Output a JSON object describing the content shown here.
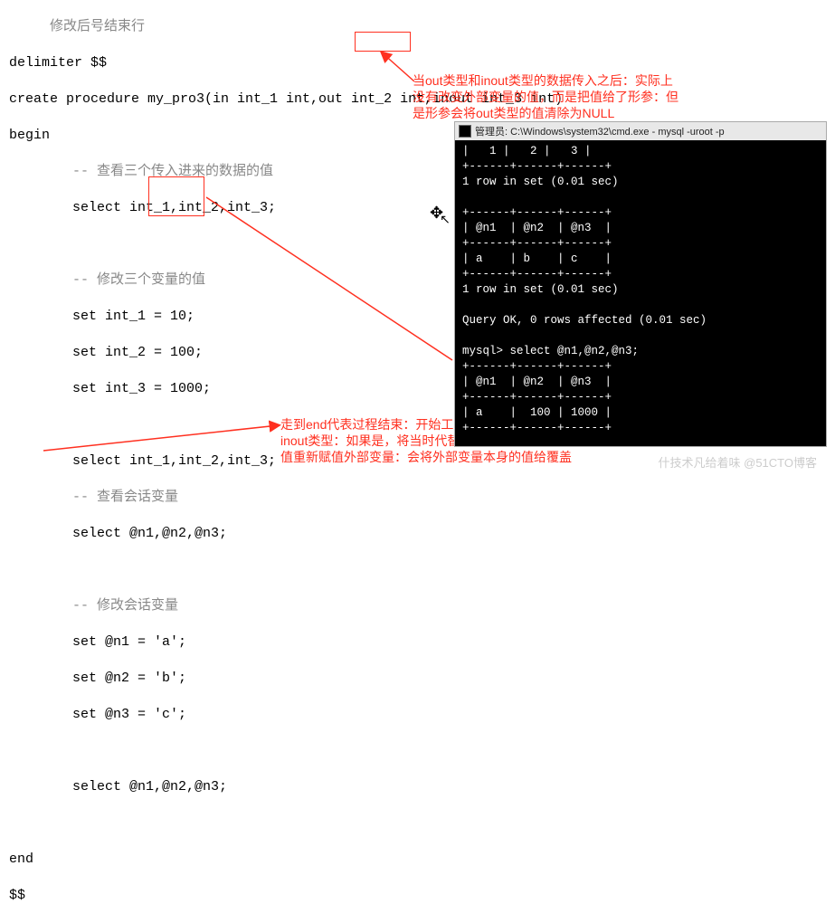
{
  "code": {
    "l0": "     修改后号结束行",
    "l1": "delimiter $$",
    "l2": "create procedure my_pro3(in int_1 int,out int_2 int,inout int_3 int)",
    "l3": "begin",
    "c1": "-- 查看三个传入进来的数据的值",
    "l4": "select int_1,int_2,int_3;",
    "c2": "-- 修改三个变量的值",
    "l5": "set int_1 = 10;",
    "l6": "set int_2 = 100;",
    "l7": "set int_3 = 1000;",
    "l8": "select int_1,int_2,int_3;",
    "c3": "-- 查看会话变量",
    "l9": "select @n1,@n2,@n3;",
    "c4": "-- 修改会话变量",
    "l10": "set @n1 = 'a';",
    "l11": "set @n2 = 'b';",
    "l12": "set @n3 = 'c';",
    "l13": "select @n1,@n2,@n3;",
    "l14": "end",
    "l15": "$$"
  },
  "annotations": {
    "a1": "当out类型和inout类型的数据传入之后：实际上\n没有改变外部变量的值，而是把值给了形参：但\n是形参会将out类型的值清除为NULL",
    "a2": "走到end代表过程结束：开始工作，判断变量是否是out或者\ninout类型：如果是，将当时代替out和inout变量的对应形参的\n值重新赋值外部变量：会将外部变量本身的值给覆盖"
  },
  "terminal": {
    "title": "管理员: C:\\Windows\\system32\\cmd.exe - mysql  -uroot -p",
    "body": "|   1 |   2 |   3 |\n+------+------+------+\n1 row in set (0.01 sec)\n\n+------+------+------+\n| @n1  | @n2  | @n3  |\n+------+------+------+\n| a    | b    | c    |\n+------+------+------+\n1 row in set (0.01 sec)\n\nQuery OK, 0 rows affected (0.01 sec)\n\nmysql> select @n1,@n2,@n3;\n+------+------+------+\n| @n1  | @n2  | @n3  |\n+------+------+------+\n| a    |  100 | 1000 |\n+------+------+------+"
  },
  "watermark": "什技术凡给着味 @51CTO博客"
}
